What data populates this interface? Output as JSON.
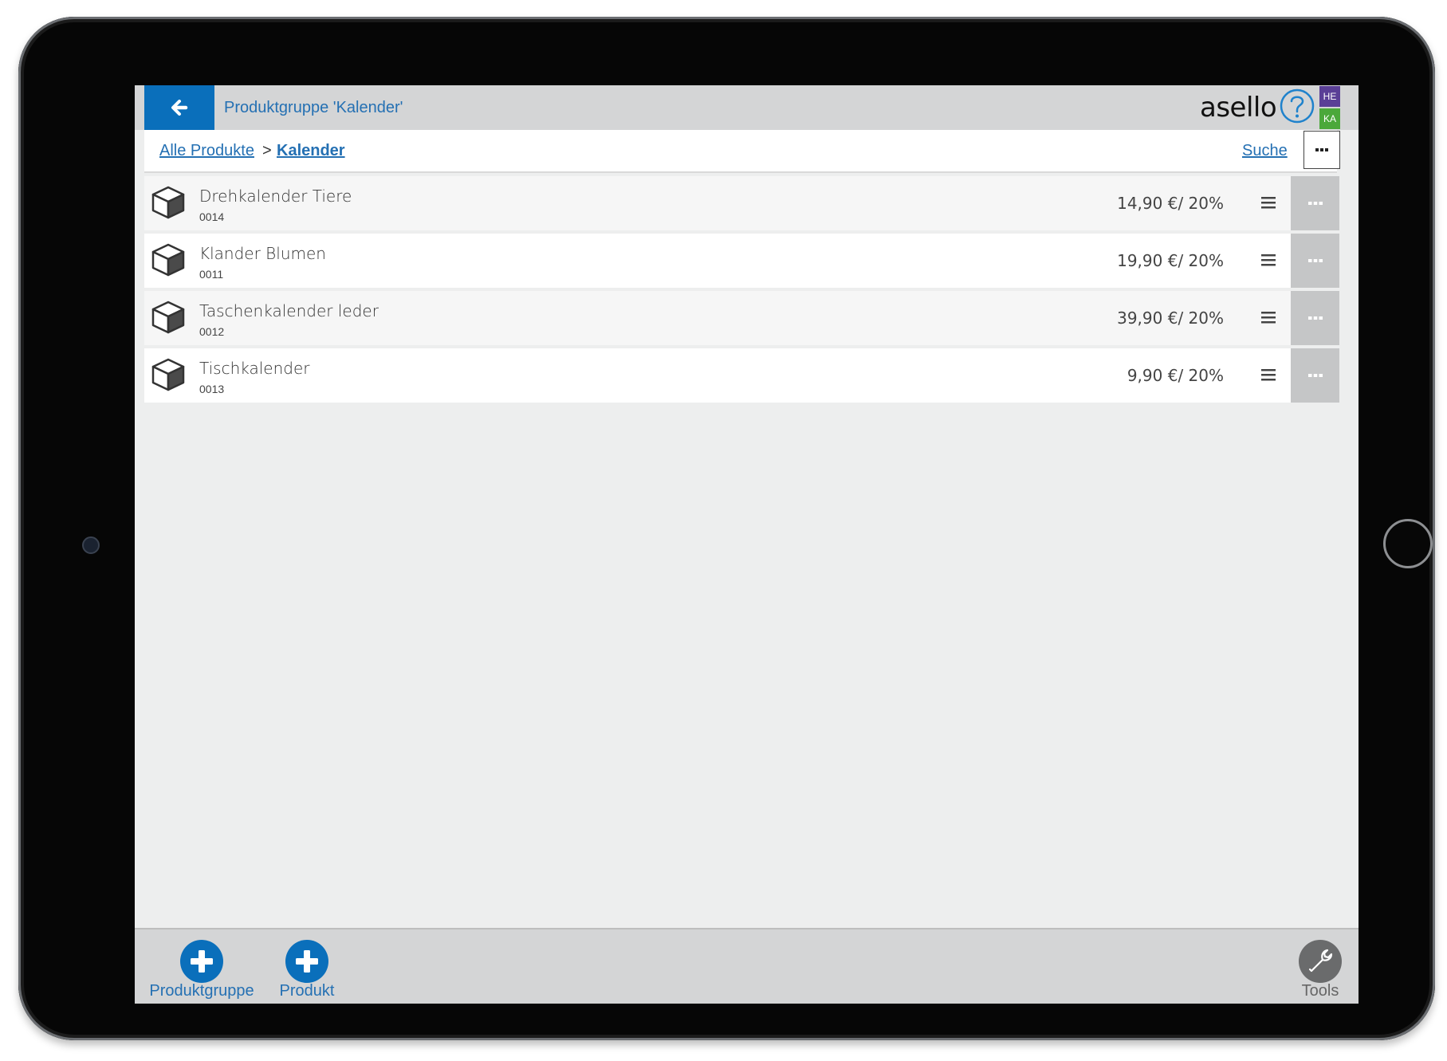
{
  "header": {
    "title": "Produktgruppe 'Kalender'",
    "logo": "asello",
    "back_icon": "arrow-left-icon",
    "help_icon": "question-circle-icon",
    "user_badges": [
      "HE",
      "KA"
    ]
  },
  "breadcrumb": {
    "root": "Alle Produkte",
    "separator": ">",
    "current": "Kalender",
    "search": "Suche"
  },
  "products": [
    {
      "name": "Drehkalender Tiere",
      "code": "0014",
      "price": "14,90 €/ 20%"
    },
    {
      "name": "Klander Blumen",
      "code": "0011",
      "price": "19,90 €/ 20%"
    },
    {
      "name": "Taschenkalender leder",
      "code": "0012",
      "price": "39,90 €/ 20%"
    },
    {
      "name": "Tischkalender",
      "code": "0013",
      "price": "9,90 €/ 20%"
    }
  ],
  "footer": {
    "add_group_label": "Produktgruppe",
    "add_product_label": "Produkt",
    "tools_label": "Tools"
  },
  "colors": {
    "accent": "#0a6fbb",
    "link": "#2470b3",
    "badge_he": "#5a3f96",
    "badge_ka": "#4ba83a",
    "bar": "#d4d5d6"
  }
}
